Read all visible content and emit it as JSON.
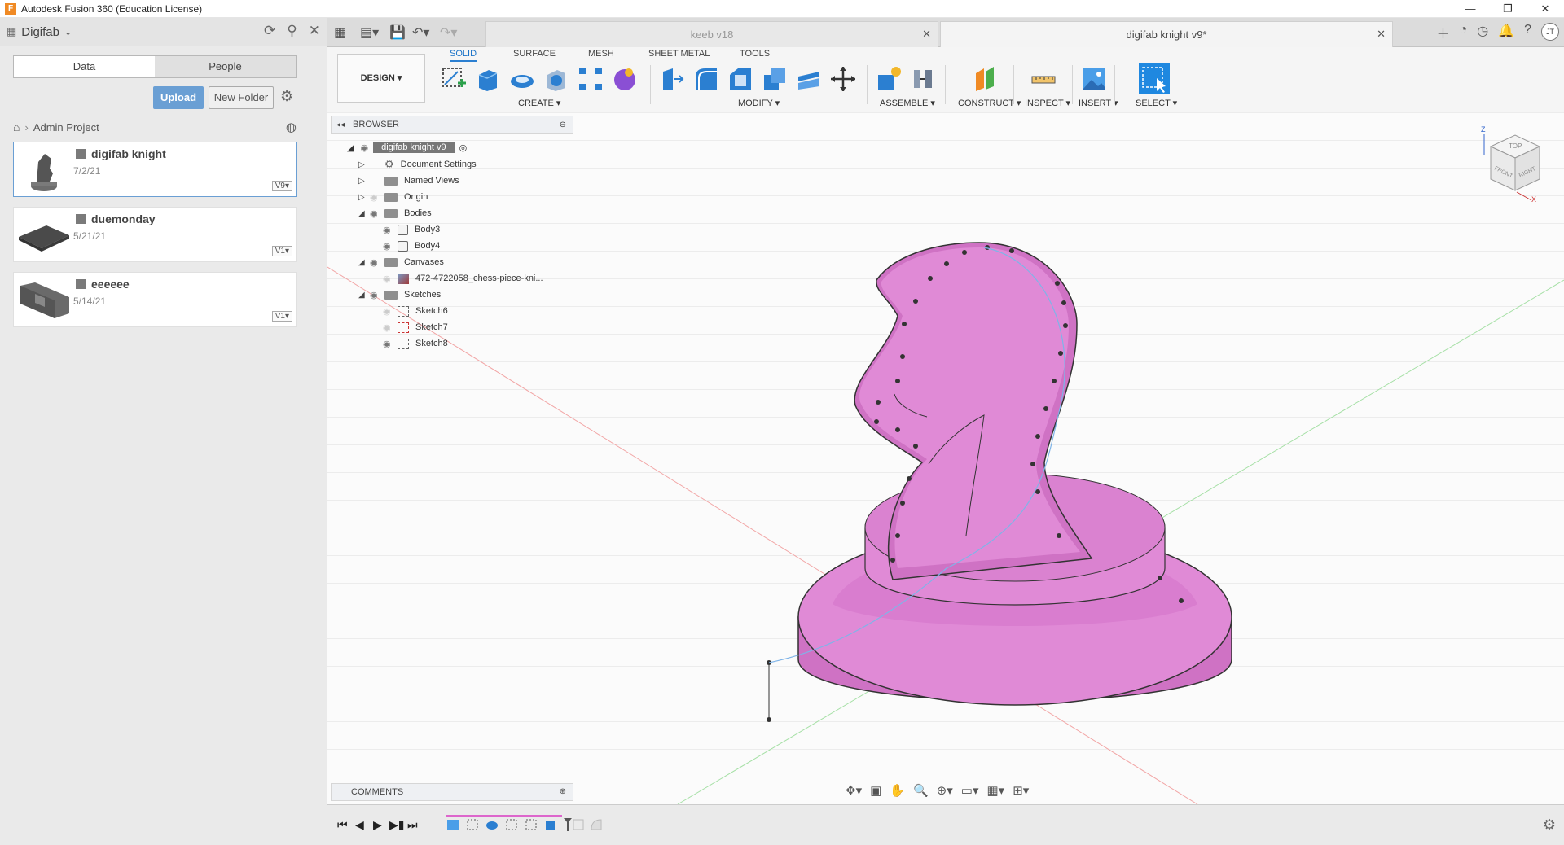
{
  "window": {
    "title": "Autodesk Fusion 360 (Education License)",
    "app_icon_letter": "F",
    "controls": [
      "—",
      "❐",
      "✕"
    ]
  },
  "data_panel": {
    "team": "Digifab",
    "tabs": [
      {
        "label": "Data",
        "active": true
      },
      {
        "label": "People",
        "active": false
      }
    ],
    "upload_label": "Upload",
    "new_folder_label": "New Folder",
    "breadcrumb": "Admin Project",
    "files": [
      {
        "name": "digifab knight",
        "date": "7/2/21",
        "version": "V9▾",
        "selected": true
      },
      {
        "name": "duemonday",
        "date": "5/21/21",
        "version": "V1▾",
        "selected": false
      },
      {
        "name": "eeeeee",
        "date": "5/14/21",
        "version": "V1▾",
        "selected": false
      }
    ]
  },
  "doc_tabs": [
    {
      "label": "keeb v18",
      "active": false
    },
    {
      "label": "digifab knight v9*",
      "active": true
    }
  ],
  "user_initials": "JT",
  "toolbar": {
    "workspace": "DESIGN ▾",
    "workspace_tabs": [
      {
        "label": "SOLID",
        "active": true
      },
      {
        "label": "SURFACE",
        "active": false
      },
      {
        "label": "MESH",
        "active": false
      },
      {
        "label": "SHEET METAL",
        "active": false
      },
      {
        "label": "TOOLS",
        "active": false
      }
    ],
    "groups": [
      "CREATE ▾",
      "MODIFY ▾",
      "ASSEMBLE ▾",
      "CONSTRUCT ▾",
      "INSPECT ▾",
      "INSERT ▾",
      "SELECT ▾"
    ]
  },
  "browser": {
    "title": "BROWSER",
    "root": "digifab knight v9",
    "items": [
      {
        "label": "Document Settings",
        "type": "settings"
      },
      {
        "label": "Named Views",
        "type": "folder"
      },
      {
        "label": "Origin",
        "type": "folder"
      },
      {
        "label": "Bodies",
        "type": "folder"
      },
      {
        "label": "Body3",
        "type": "body"
      },
      {
        "label": "Body4",
        "type": "body"
      },
      {
        "label": "Canvases",
        "type": "folder"
      },
      {
        "label": "472-4722058_chess-piece-kni...",
        "type": "canvas"
      },
      {
        "label": "Sketches",
        "type": "folder"
      },
      {
        "label": "Sketch6",
        "type": "sketch"
      },
      {
        "label": "Sketch7",
        "type": "sketch"
      },
      {
        "label": "Sketch8",
        "type": "sketch"
      }
    ]
  },
  "viewcube": {
    "top": "TOP",
    "front": "FRONT",
    "right": "RIGHT",
    "axis_z": "Z",
    "axis_x": "X"
  },
  "comments_label": "COMMENTS",
  "colors": {
    "model_pink": "#e08ad6",
    "accent_blue": "#2b7fd1",
    "upload_blue": "#6a9fd4"
  }
}
